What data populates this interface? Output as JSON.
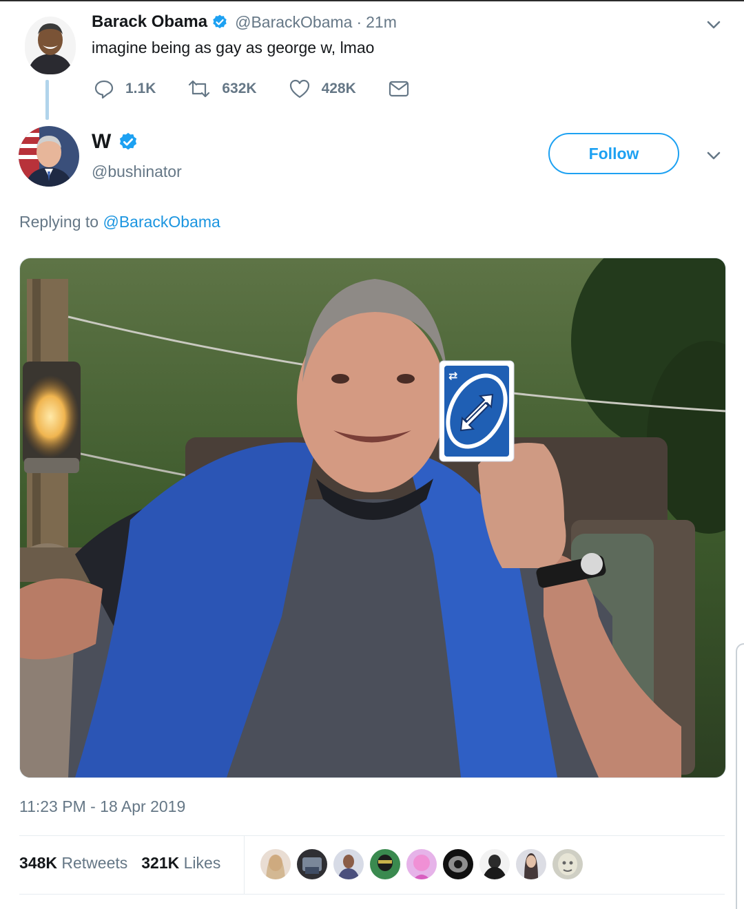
{
  "original_tweet": {
    "author_name": "Barack Obama",
    "handle": "@BarackObama",
    "separator": "·",
    "age": "21m",
    "text": "imagine being as gay as george w, lmao",
    "reply_count": "1.1K",
    "retweet_count": "632K",
    "like_count": "428K"
  },
  "reply_tweet": {
    "author_name": "W",
    "handle": "@bushinator",
    "follow_label": "Follow",
    "replying_prefix": "Replying to",
    "replying_to": "@BarackObama",
    "timestamp": "11:23 PM - 18 Apr 2019",
    "retweets_count": "348K",
    "retweets_label": "Retweets",
    "likes_count": "321K",
    "likes_label": "Likes"
  },
  "colors": {
    "accent": "#1da1f2",
    "muted": "#657786",
    "text": "#14171a",
    "uno_card_blue": "#1f5fb4"
  },
  "icons": [
    "verified-badge-icon",
    "chevron-down-icon",
    "reply-icon",
    "retweet-icon",
    "like-heart-icon",
    "message-icon"
  ]
}
